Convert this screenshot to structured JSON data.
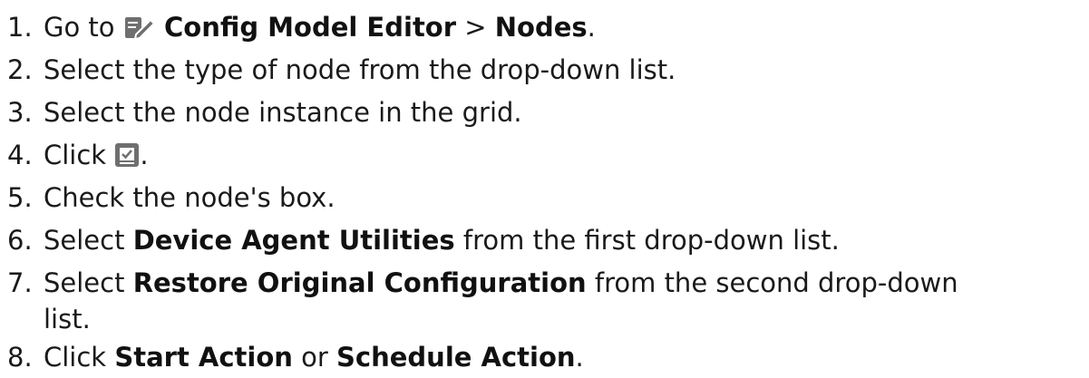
{
  "steps": [
    {
      "number": "1.",
      "parts": [
        "Go to ",
        "Config Model Editor",
        " > ",
        "Nodes",
        "."
      ],
      "icon": "editor-pencil-icon"
    },
    {
      "number": "2.",
      "text": "Select the type of node from the drop-down list."
    },
    {
      "number": "3.",
      "text": "Select the node instance in the grid."
    },
    {
      "number": "4.",
      "parts": [
        "Click ",
        "."
      ],
      "icon": "actions-checkbox-icon"
    },
    {
      "number": "5.",
      "text": "Check the node's box."
    },
    {
      "number": "6.",
      "parts": [
        "Select ",
        "Device Agent Utilities",
        " from the first drop-down list."
      ]
    },
    {
      "number": "7.",
      "parts": [
        "Select ",
        "Restore Original Configuration",
        " from the second drop-down",
        "list."
      ]
    },
    {
      "number": "8.",
      "parts": [
        "Click ",
        "Start Action",
        " or ",
        "Schedule Action",
        "."
      ]
    }
  ],
  "colors": {
    "text": "#1a1a1a",
    "icon_fill": "#6f6f6f"
  }
}
